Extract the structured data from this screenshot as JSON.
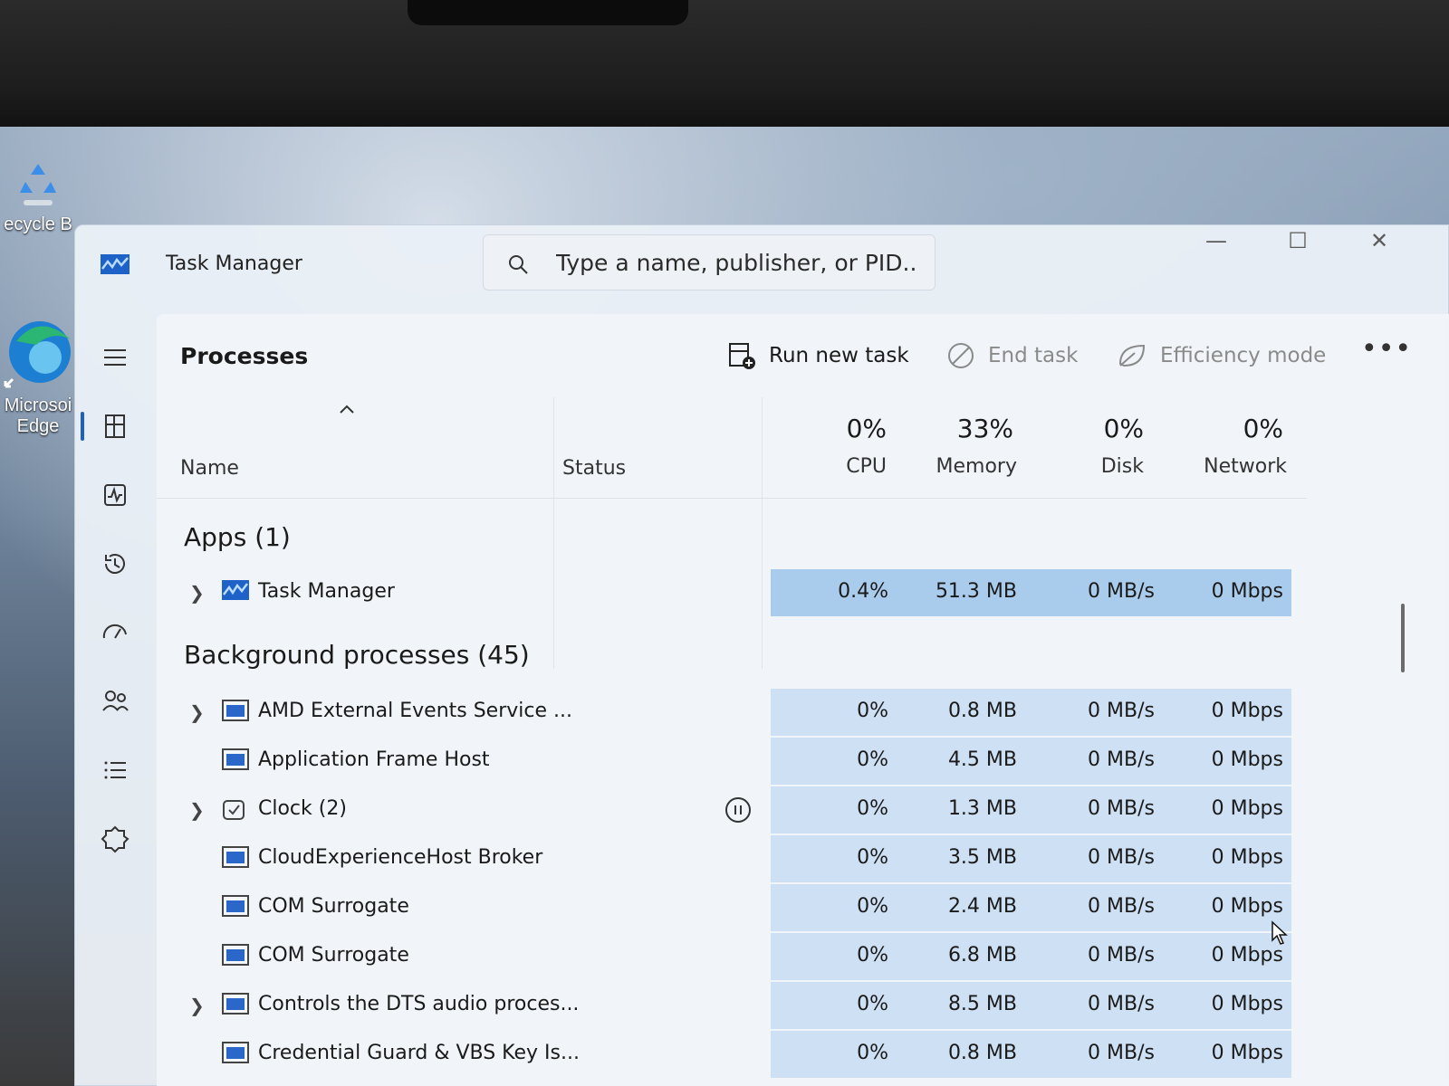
{
  "desktop": {
    "icons": [
      {
        "id": "recycle",
        "label": "ecycle B"
      },
      {
        "id": "edge",
        "label": "Microsoi\nEdge"
      }
    ]
  },
  "window": {
    "title": "Task Manager",
    "controls": {
      "minimize": "—",
      "maximize": "☐",
      "close": "✕"
    }
  },
  "search": {
    "placeholder": "Type a name, publisher, or PID..."
  },
  "page": {
    "title": "Processes"
  },
  "toolbar": {
    "run_new_task": "Run new task",
    "end_task": "End task",
    "efficiency_mode": "Efficiency mode",
    "more": "•••"
  },
  "columns": {
    "name": "Name",
    "status": "Status",
    "cpu": {
      "pct": "0%",
      "label": "CPU"
    },
    "memory": {
      "pct": "33%",
      "label": "Memory"
    },
    "disk": {
      "pct": "0%",
      "label": "Disk"
    },
    "network": {
      "pct": "0%",
      "label": "Network"
    }
  },
  "groups": {
    "apps": {
      "title": "Apps (1)",
      "rows": [
        {
          "name": "Task Manager",
          "expandable": true,
          "icon": "task-manager-icon",
          "cpu": "0.4%",
          "memory": "51.3 MB",
          "disk": "0 MB/s",
          "network": "0 Mbps"
        }
      ]
    },
    "background": {
      "title": "Background processes (45)",
      "rows": [
        {
          "name": "AMD External Events Service ...",
          "expandable": true,
          "icon": "window-app-icon",
          "cpu": "0%",
          "memory": "0.8 MB",
          "disk": "0 MB/s",
          "network": "0 Mbps"
        },
        {
          "name": "Application Frame Host",
          "expandable": false,
          "icon": "window-app-icon",
          "cpu": "0%",
          "memory": "4.5 MB",
          "disk": "0 MB/s",
          "network": "0 Mbps"
        },
        {
          "name": "Clock (2)",
          "expandable": true,
          "icon": "clock-app-icon",
          "status_icon": "pause-icon",
          "cpu": "0%",
          "memory": "1.3 MB",
          "disk": "0 MB/s",
          "network": "0 Mbps"
        },
        {
          "name": "CloudExperienceHost Broker",
          "expandable": false,
          "icon": "window-app-icon",
          "cpu": "0%",
          "memory": "3.5 MB",
          "disk": "0 MB/s",
          "network": "0 Mbps"
        },
        {
          "name": "COM Surrogate",
          "expandable": false,
          "icon": "window-app-icon",
          "cpu": "0%",
          "memory": "2.4 MB",
          "disk": "0 MB/s",
          "network": "0 Mbps"
        },
        {
          "name": "COM Surrogate",
          "expandable": false,
          "icon": "window-app-icon",
          "cpu": "0%",
          "memory": "6.8 MB",
          "disk": "0 MB/s",
          "network": "0 Mbps"
        },
        {
          "name": "Controls the DTS audio proces...",
          "expandable": true,
          "icon": "window-app-icon",
          "cpu": "0%",
          "memory": "8.5 MB",
          "disk": "0 MB/s",
          "network": "0 Mbps"
        },
        {
          "name": "Credential Guard & VBS Key Is...",
          "expandable": false,
          "icon": "window-app-icon",
          "cpu": "0%",
          "memory": "0.8 MB",
          "disk": "0 MB/s",
          "network": "0 Mbps"
        }
      ]
    }
  },
  "nav": {
    "items": [
      "hamburger-menu-icon",
      "processes-icon",
      "performance-icon",
      "app-history-icon",
      "startup-apps-icon",
      "users-icon",
      "details-icon",
      "services-icon"
    ],
    "active": "processes-icon"
  },
  "colors": {
    "accent": "#1f5fbf",
    "app_row_highlight": "#8cbae6",
    "metric_highlight": "#b0ceec"
  }
}
